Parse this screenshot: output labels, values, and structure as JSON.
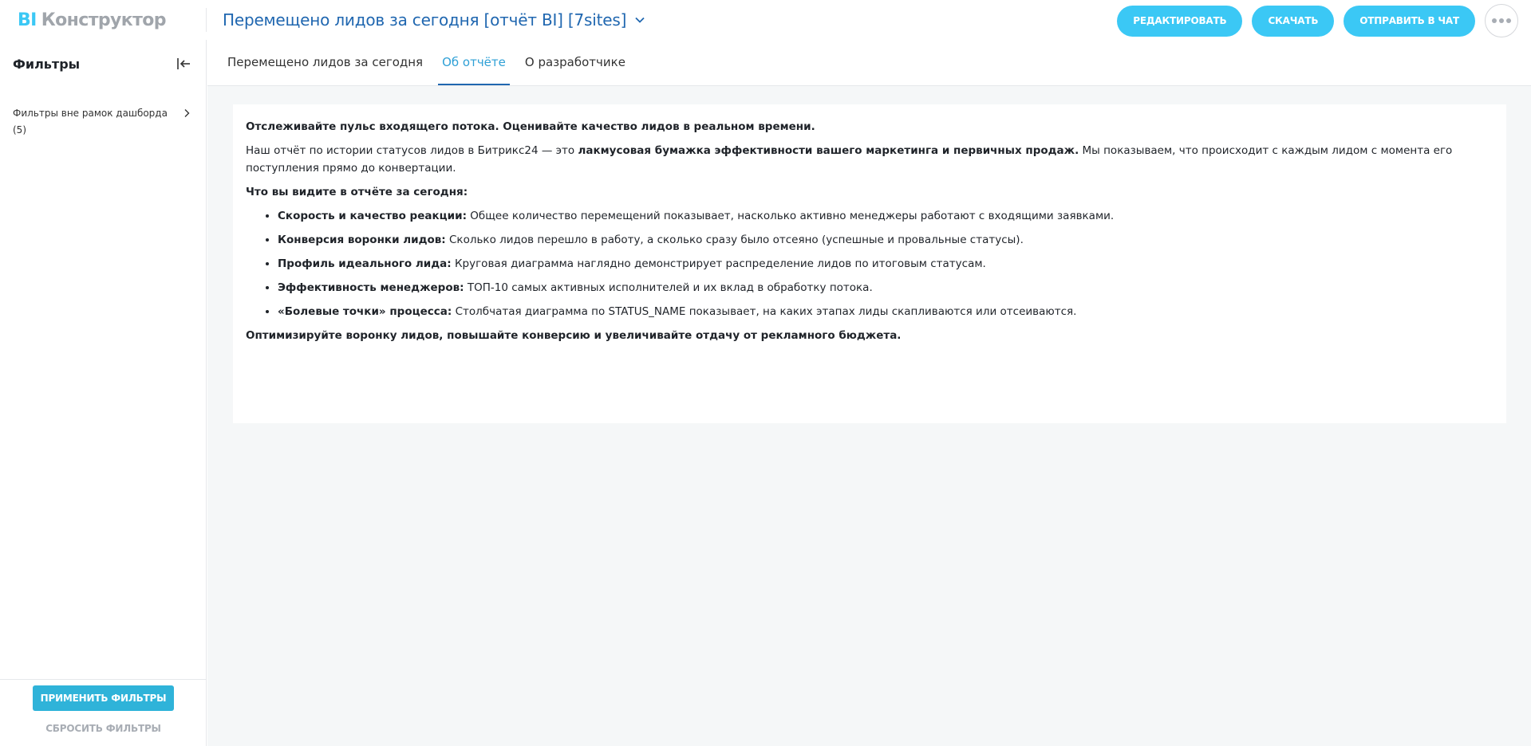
{
  "header": {
    "logo_bi": "BI",
    "logo_text": "Конструктор",
    "report_title": "Перемещено лидов за сегодня [отчёт BI] [7sites]",
    "buttons": {
      "edit": "РЕДАКТИРОВАТЬ",
      "download": "СКАЧАТЬ",
      "send_chat": "ОТПРАВИТЬ В ЧАТ"
    }
  },
  "sidebar": {
    "title": "Фильтры",
    "filter_group": "Фильтры вне рамок дашборда (5)",
    "apply": "ПРИМЕНИТЬ ФИЛЬТРЫ",
    "reset": "СБРОСИТЬ ФИЛЬТРЫ"
  },
  "tabs": [
    {
      "label": "Перемещено лидов за сегодня",
      "active": false
    },
    {
      "label": "Об отчёте",
      "active": true
    },
    {
      "label": "О разработчике",
      "active": false
    }
  ],
  "about": {
    "headline": "Отслеживайте пульс входящего потока. Оценивайте качество лидов в реальном времени.",
    "intro_pre": "Наш отчёт по истории статусов лидов в Битрикс24 — это ",
    "intro_bold": "лакмусовая бумажка эффективности вашего маркетинга и первичных продаж.",
    "intro_post": " Мы показываем, что происходит с каждым лидом с момента его поступления прямо до конвертации.",
    "list_title": "Что вы видите в отчёте за сегодня:",
    "items": [
      {
        "bold": "Скорость и качество реакции:",
        "text": " Общее количество перемещений показывает, насколько активно менеджеры работают с входящими заявками."
      },
      {
        "bold": "Конверсия воронки лидов:",
        "text": " Сколько лидов перешло в работу, а сколько сразу было отсеяно (успешные и провальные статусы)."
      },
      {
        "bold": "Профиль идеального лида:",
        "text": " Круговая диаграмма наглядно демонстрирует распределение лидов по итоговым статусам."
      },
      {
        "bold": "Эффективность менеджеров:",
        "text": " ТОП-10 самых активных исполнителей и их вклад в обработку потока."
      },
      {
        "bold": "«Болевые точки» процесса:",
        "text": " Столбчатая диаграмма по STATUS_NAME показывает, на каких этапах лиды скапливаются или отсеиваются."
      }
    ],
    "closing": "Оптимизируйте воронку лидов, повышайте конверсию и увеличивайте отдачу от рекламного бюджета."
  },
  "colors": {
    "accent": "#3bc8f5",
    "title_blue": "#2067b0",
    "tab_active": "#2fa0d6"
  }
}
